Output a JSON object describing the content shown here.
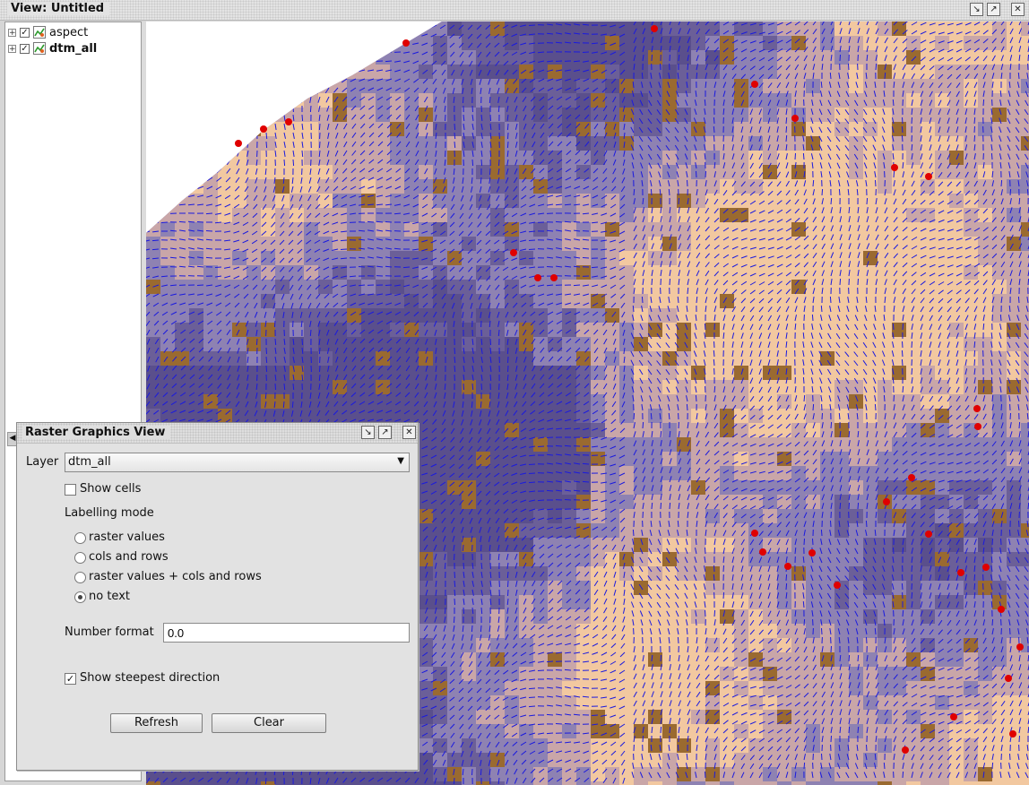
{
  "view_window": {
    "title": "View: Untitled"
  },
  "toc": {
    "layers": [
      {
        "name": "aspect",
        "checked": true,
        "bold": false
      },
      {
        "name": "dtm_all",
        "checked": true,
        "bold": true
      }
    ]
  },
  "map": {
    "flow_color": "#1a1adf",
    "outlet_color": "#e00000",
    "terrain_light": "#f2c8a0",
    "terrain_dark": "#5a4f8c"
  },
  "dialog": {
    "title": "Raster Graphics View",
    "layer_label": "Layer",
    "layer_value": "dtm_all",
    "show_cells_label": "Show cells",
    "show_cells_checked": false,
    "labelling_mode_label": "Labelling mode",
    "labelling_options": [
      {
        "label": "raster values",
        "selected": false
      },
      {
        "label": "cols and rows",
        "selected": false
      },
      {
        "label": "raster values + cols and rows",
        "selected": false
      },
      {
        "label": "no text",
        "selected": true
      }
    ],
    "number_format_label": "Number format",
    "number_format_value": "0.0",
    "steepest_label": "Show steepest direction",
    "steepest_checked": true,
    "refresh_label": "Refresh",
    "clear_label": "Clear"
  }
}
